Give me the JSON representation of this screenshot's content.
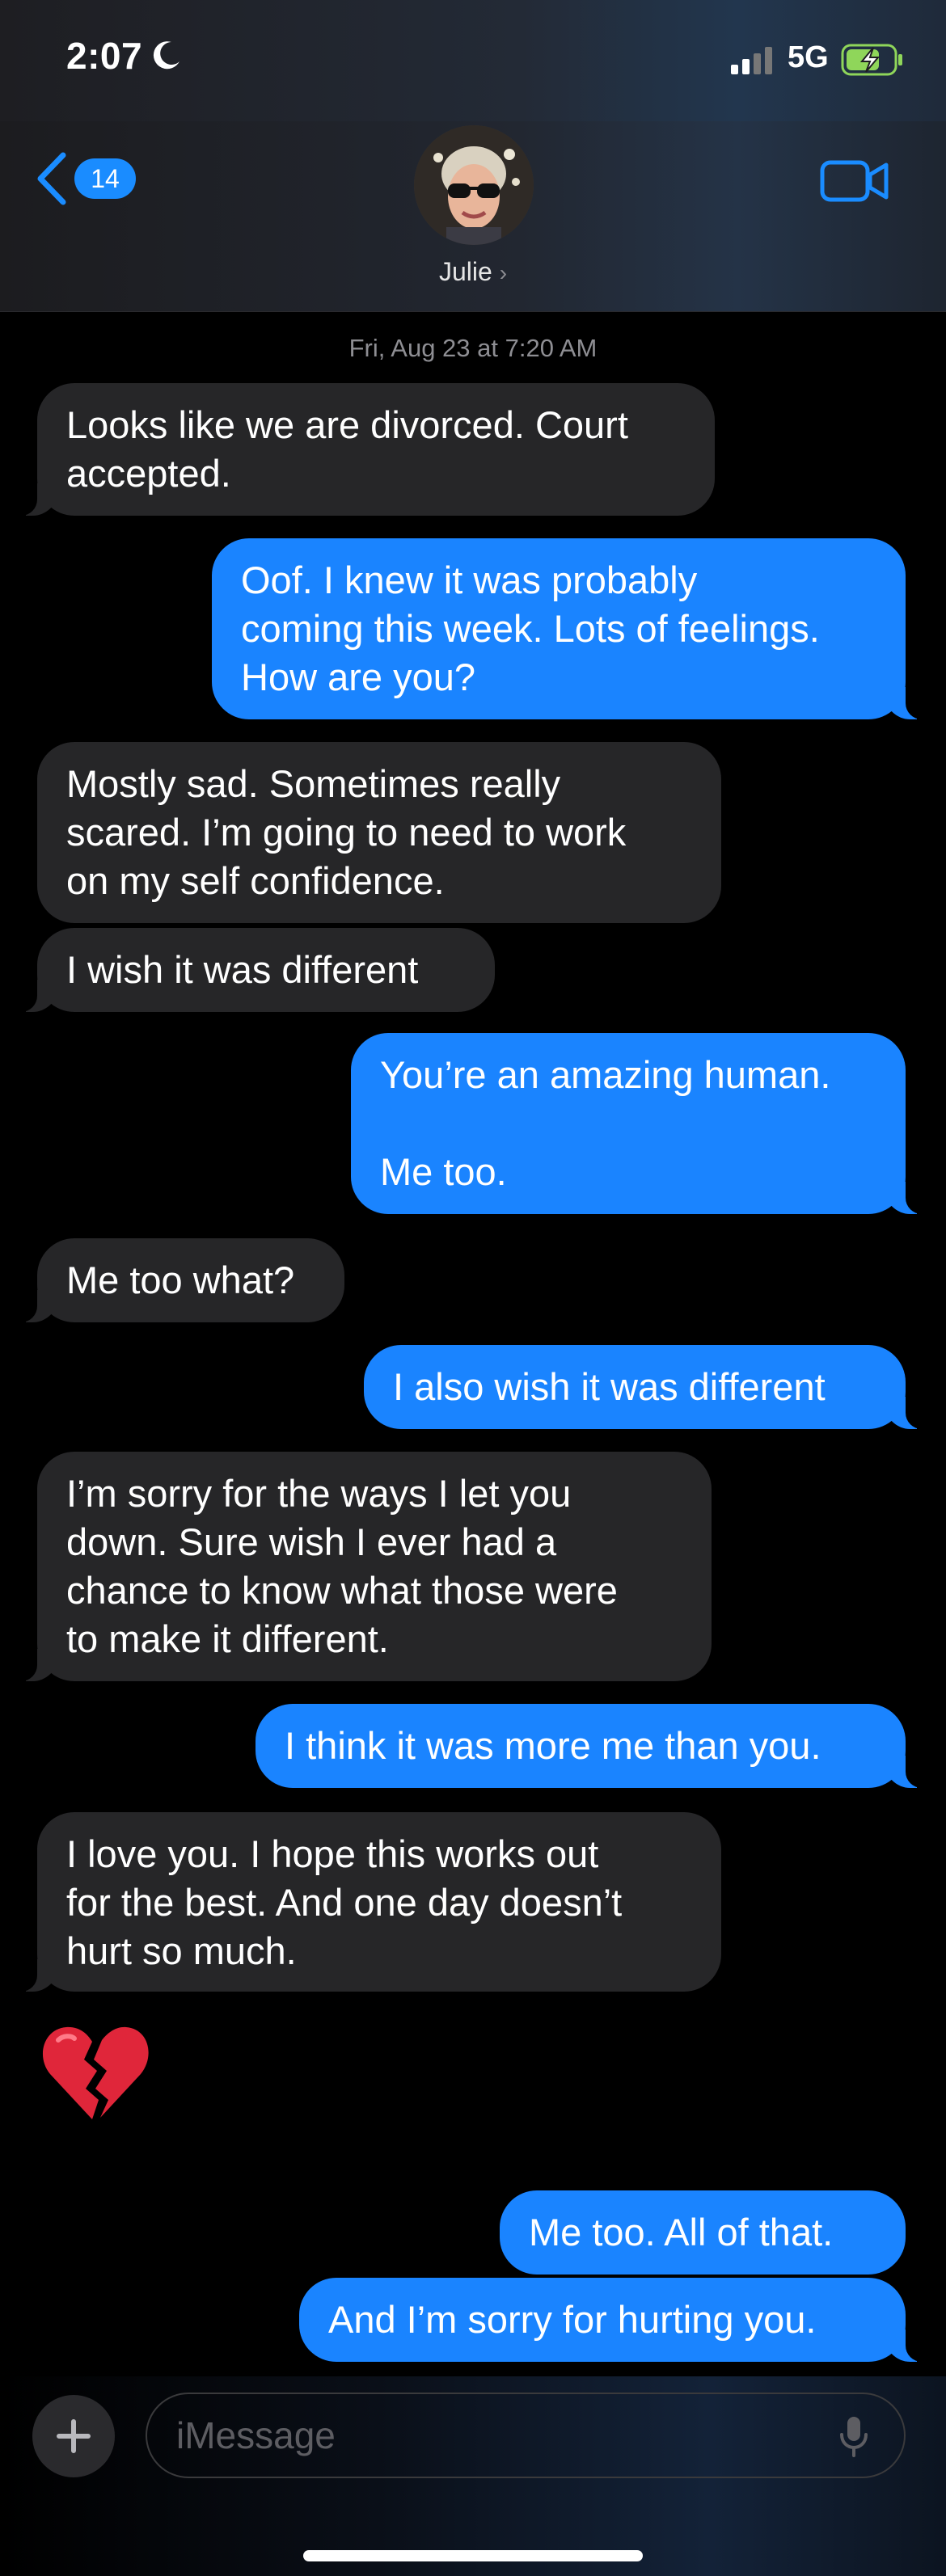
{
  "status_bar": {
    "time": "2:07",
    "network": "5G"
  },
  "header": {
    "unread_count": "14",
    "contact_name": "Julie"
  },
  "conversation": {
    "timestamp": "Fri, Aug 23 at 7:20 AM",
    "messages": [
      {
        "from": "them",
        "text": "Looks like we are divorced. Court\naccepted."
      },
      {
        "from": "me",
        "text": "Oof. I knew it was probably\ncoming this week. Lots of feelings.\nHow are you?"
      },
      {
        "from": "them",
        "text": "Mostly sad. Sometimes really\nscared. I’m going to need to work\non my self confidence."
      },
      {
        "from": "them",
        "text": "I wish it was different"
      },
      {
        "from": "me",
        "text": "You’re an amazing human.\n\nMe too."
      },
      {
        "from": "them",
        "text": "Me too what?"
      },
      {
        "from": "me",
        "text": "I also wish it was different"
      },
      {
        "from": "them",
        "text": "I’m sorry for the ways I let you\ndown. Sure wish I ever had a\nchance to know what those were\nto make it different."
      },
      {
        "from": "me",
        "text": "I think it was more me than you."
      },
      {
        "from": "them",
        "text": "I love you. I hope this works out\nfor the best. And one day doesn’t\nhurt so much."
      },
      {
        "from": "them",
        "text": "💔"
      },
      {
        "from": "me",
        "text": "Me too. All of that."
      },
      {
        "from": "me",
        "text": "And I’m sorry for hurting you."
      }
    ]
  },
  "composer": {
    "placeholder": "iMessage"
  },
  "colors": {
    "outgoing_bubble": "#1a84ff",
    "incoming_bubble": "#262628",
    "accent": "#1a8cff"
  }
}
